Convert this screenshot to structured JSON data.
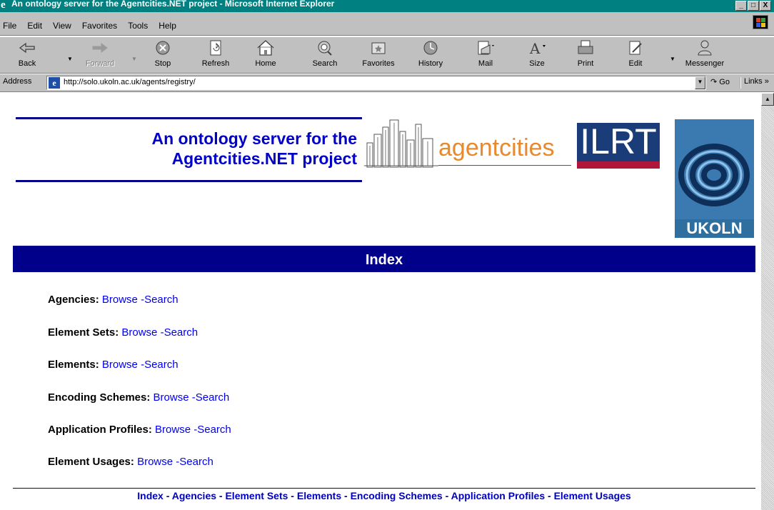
{
  "window": {
    "title": "An ontology server for the Agentcities.NET project - Microsoft Internet Explorer",
    "buttons": [
      "_",
      "□",
      "X"
    ]
  },
  "menu": [
    "File",
    "Edit",
    "View",
    "Favorites",
    "Tools",
    "Help"
  ],
  "toolbar": {
    "buttons": [
      {
        "label": "Back",
        "icon": "back-arrow-icon",
        "disabled": false
      },
      {
        "label": "Forward",
        "icon": "forward-arrow-icon",
        "disabled": true
      },
      {
        "label": "Stop",
        "icon": "stop-icon",
        "disabled": false
      },
      {
        "label": "Refresh",
        "icon": "refresh-icon",
        "disabled": false
      },
      {
        "label": "Home",
        "icon": "home-icon",
        "disabled": false
      },
      {
        "label": "Search",
        "icon": "search-icon",
        "disabled": false
      },
      {
        "label": "Favorites",
        "icon": "favorites-icon",
        "disabled": false
      },
      {
        "label": "History",
        "icon": "history-icon",
        "disabled": false
      },
      {
        "label": "Mail",
        "icon": "mail-icon",
        "disabled": false
      },
      {
        "label": "Size",
        "icon": "font-size-icon",
        "disabled": false
      },
      {
        "label": "Print",
        "icon": "print-icon",
        "disabled": false
      },
      {
        "label": "Edit",
        "icon": "edit-icon",
        "disabled": false
      },
      {
        "label": "Messenger",
        "icon": "messenger-icon",
        "disabled": false
      }
    ]
  },
  "address": {
    "label": "Address",
    "url": "http://solo.ukoln.ac.uk/agents/registry/",
    "go": "Go",
    "links": "Links »"
  },
  "page": {
    "title_line1": "An ontology server for the",
    "title_line2": "Agentcities.NET project",
    "logos": {
      "agentcities": "agentcities",
      "ilrt": "ILRT",
      "ukoln": "UKOLN"
    },
    "index_header": "Index",
    "entries": [
      {
        "label": "Agencies:",
        "browse": "Browse",
        "search": "-Search"
      },
      {
        "label": "Element Sets:",
        "browse": "Browse",
        "search": "-Search"
      },
      {
        "label": "Elements:",
        "browse": "Browse",
        "search": "-Search"
      },
      {
        "label": "Encoding Schemes:",
        "browse": "Browse",
        "search": "-Search"
      },
      {
        "label": "Application Profiles:",
        "browse": "Browse",
        "search": "-Search"
      },
      {
        "label": "Element Usages:",
        "browse": "Browse",
        "search": "-Search"
      }
    ],
    "footer_nav": [
      "Index",
      "Agencies",
      "Element Sets",
      "Elements",
      "Encoding Schemes",
      "Application Profiles",
      "Element Usages"
    ],
    "footer_separator": " - "
  },
  "colors": {
    "titlebar": "#008080",
    "chrome": "#c0c0c0",
    "header_blue": "#00008b",
    "link_blue": "#0000ee",
    "title_blue": "#0000c8",
    "agentcities_orange": "#e8892b"
  }
}
